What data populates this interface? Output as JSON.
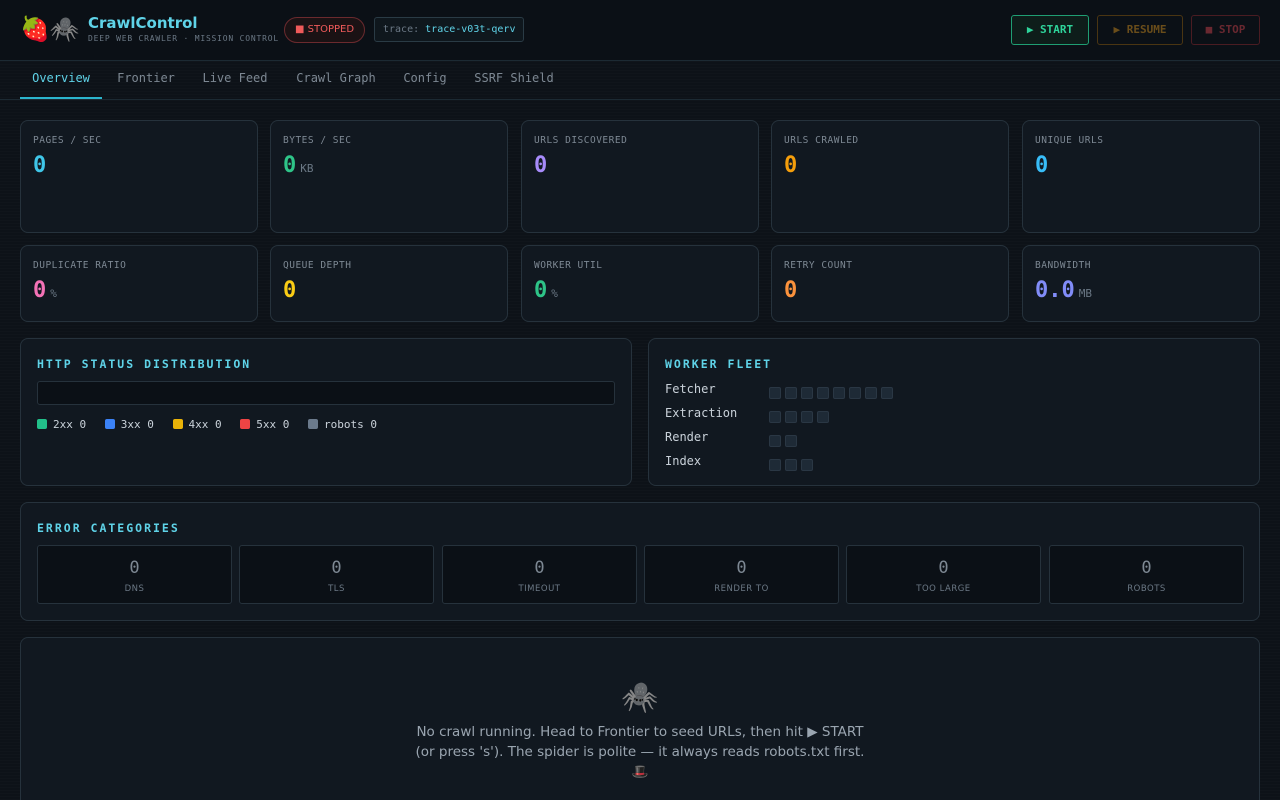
{
  "app": {
    "logo_emoji": "🍓🕷️",
    "title": "CrawlControl",
    "subtitle": "DEEP WEB CRAWLER · MISSION CONTROL",
    "status": "■ STOPPED",
    "trace_label": "trace:",
    "trace_id": "trace-v03t-qerv"
  },
  "controls": {
    "start": "▶ START",
    "resume": "▶ RESUME",
    "stop": "■ STOP"
  },
  "tabs": [
    {
      "label": "Overview",
      "active": true
    },
    {
      "label": "Frontier",
      "active": false
    },
    {
      "label": "Live Feed",
      "active": false
    },
    {
      "label": "Crawl Graph",
      "active": false
    },
    {
      "label": "Config",
      "active": false
    },
    {
      "label": "SSRF Shield",
      "active": false
    }
  ],
  "metrics_row1": [
    {
      "label": "PAGES / SEC",
      "value": "0",
      "unit": "",
      "color": "#3fc6e8"
    },
    {
      "label": "BYTES / SEC",
      "value": "0",
      "unit": "KB",
      "color": "#2ec488"
    },
    {
      "label": "URLS DISCOVERED",
      "value": "0",
      "unit": "",
      "color": "#a78bfa"
    },
    {
      "label": "URLS CRAWLED",
      "value": "0",
      "unit": "",
      "color": "#f59e0b"
    },
    {
      "label": "UNIQUE URLS",
      "value": "0",
      "unit": "",
      "color": "#38bdf8"
    }
  ],
  "metrics_row2": [
    {
      "label": "DUPLICATE RATIO",
      "value": "0",
      "unit": "%",
      "color": "#f472b6"
    },
    {
      "label": "QUEUE DEPTH",
      "value": "0",
      "unit": "",
      "color": "#facc15"
    },
    {
      "label": "WORKER UTIL",
      "value": "0",
      "unit": "%",
      "color": "#2ec488"
    },
    {
      "label": "RETRY COUNT",
      "value": "0",
      "unit": "",
      "color": "#fb923c"
    },
    {
      "label": "BANDWIDTH",
      "value": "0.0",
      "unit": "MB",
      "color": "#818cf8"
    }
  ],
  "http_status": {
    "title": "HTTP STATUS DISTRIBUTION",
    "legend": [
      {
        "label": "2xx 0",
        "color": "#22c08a"
      },
      {
        "label": "3xx 0",
        "color": "#3b82f6"
      },
      {
        "label": "4xx 0",
        "color": "#eab308"
      },
      {
        "label": "5xx 0",
        "color": "#ef4444"
      },
      {
        "label": "robots 0",
        "color": "#6b7a8c"
      }
    ]
  },
  "worker_fleet": {
    "title": "WORKER FLEET",
    "pools": [
      {
        "name": "Fetcher",
        "workers": 8
      },
      {
        "name": "Extraction",
        "workers": 4
      },
      {
        "name": "Render",
        "workers": 2
      },
      {
        "name": "Index",
        "workers": 3
      }
    ]
  },
  "errors": {
    "title": "ERROR CATEGORIES",
    "items": [
      {
        "label": "DNS",
        "value": "0"
      },
      {
        "label": "TLS",
        "value": "0"
      },
      {
        "label": "TIMEOUT",
        "value": "0"
      },
      {
        "label": "RENDER TO",
        "value": "0"
      },
      {
        "label": "TOO LARGE",
        "value": "0"
      },
      {
        "label": "ROBOTS",
        "value": "0"
      }
    ]
  },
  "empty_state": {
    "icon": "🕷️",
    "line1": "No crawl running. Head to Frontier to seed URLs, then hit ▶ START",
    "line2": "(or press 's'). The spider is polite — it always reads robots.txt first.",
    "line3": "🎩"
  }
}
